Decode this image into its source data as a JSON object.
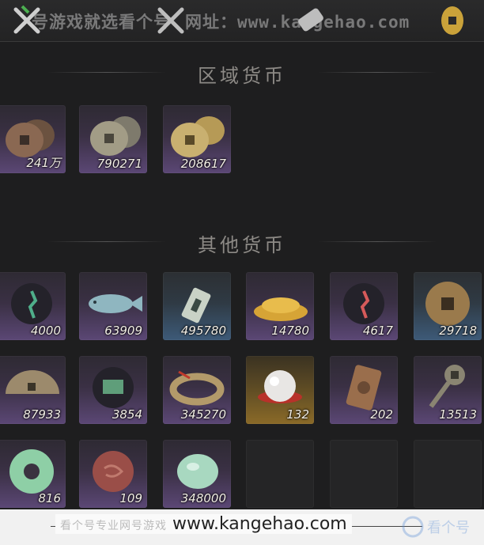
{
  "watermark_top": {
    "text": "号游戏就选看个号",
    "url": "网址：www.kangehao.com"
  },
  "sections": {
    "regional": "区域货币",
    "other": "其他货币"
  },
  "regional_items": [
    {
      "count": "241万",
      "icon": "copper-coin-stack-icon"
    },
    {
      "count": "790271",
      "icon": "silver-coin-stack-icon"
    },
    {
      "count": "208617",
      "icon": "gold-coin-stack-icon"
    }
  ],
  "other_items": [
    {
      "count": "4000",
      "icon": "green-sigil-icon"
    },
    {
      "count": "63909",
      "icon": "fish-icon"
    },
    {
      "count": "495780",
      "icon": "jade-token-icon"
    },
    {
      "count": "14780",
      "icon": "grain-pile-icon"
    },
    {
      "count": "4617",
      "icon": "red-sigil-icon"
    },
    {
      "count": "29718",
      "icon": "square-hole-coin-icon"
    },
    {
      "count": "87933",
      "icon": "half-coin-icon"
    },
    {
      "count": "3854",
      "icon": "green-badge-icon"
    },
    {
      "count": "345270",
      "icon": "coin-string-icon"
    },
    {
      "count": "132",
      "icon": "pearl-icon"
    },
    {
      "count": "202",
      "icon": "bronze-plaque-icon"
    },
    {
      "count": "13513",
      "icon": "spade-coin-icon"
    },
    {
      "count": "816",
      "icon": "jade-ring-icon"
    },
    {
      "count": "109",
      "icon": "red-stone-icon"
    },
    {
      "count": "348000",
      "icon": "jade-pebble-icon"
    }
  ],
  "watermark_bottom": {
    "text_cn": "看个号专业网号游戏",
    "url": "www.kangehao.com",
    "brand": "看个号"
  },
  "colors": {
    "background": "#1e1e1f",
    "purple_tile": "#5a4a6e",
    "blue_tile": "#3d5a78",
    "gold_tile": "#8a6a28"
  }
}
